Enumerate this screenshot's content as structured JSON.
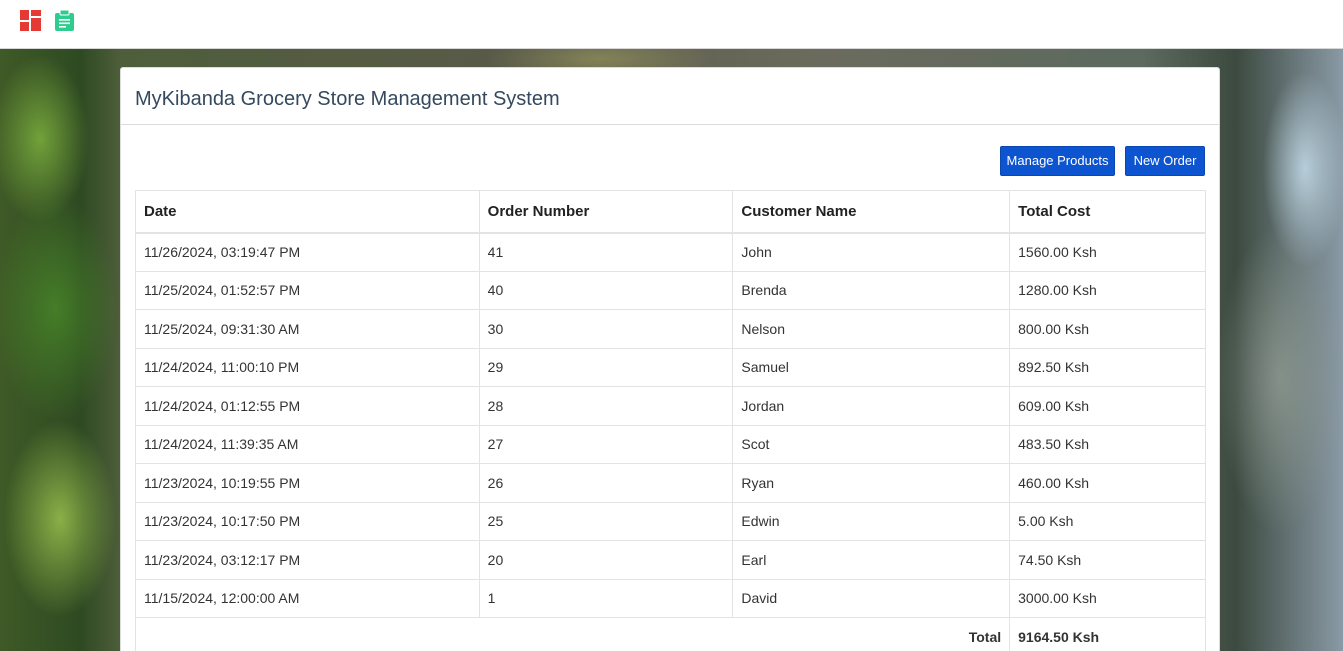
{
  "header": {
    "icons": [
      "dashboard-icon",
      "clipboard-icon"
    ]
  },
  "page": {
    "title": "MyKibanda Grocery Store Management System",
    "manage_products_label": "Manage Products",
    "new_order_label": "New Order"
  },
  "table": {
    "columns": [
      "Date",
      "Order Number",
      "Customer Name",
      "Total Cost"
    ],
    "rows": [
      [
        "11/26/2024, 03:19:47 PM",
        "41",
        "John",
        "1560.00 Ksh"
      ],
      [
        "11/25/2024, 01:52:57 PM",
        "40",
        "Brenda",
        "1280.00 Ksh"
      ],
      [
        "11/25/2024, 09:31:30 AM",
        "30",
        "Nelson",
        "800.00 Ksh"
      ],
      [
        "11/24/2024, 11:00:10 PM",
        "29",
        "Samuel",
        "892.50 Ksh"
      ],
      [
        "11/24/2024, 01:12:55 PM",
        "28",
        "Jordan",
        "609.00 Ksh"
      ],
      [
        "11/24/2024, 11:39:35 AM",
        "27",
        "Scot",
        "483.50 Ksh"
      ],
      [
        "11/23/2024, 10:19:55 PM",
        "26",
        "Ryan",
        "460.00 Ksh"
      ],
      [
        "11/23/2024, 10:17:50 PM",
        "25",
        "Edwin",
        "5.00 Ksh"
      ],
      [
        "11/23/2024, 03:12:17 PM",
        "20",
        "Earl",
        "74.50 Ksh"
      ],
      [
        "11/15/2024, 12:00:00 AM",
        "1",
        "David",
        "3000.00 Ksh"
      ]
    ],
    "total_label": "Total",
    "total_value": "9164.50 Ksh"
  },
  "colors": {
    "dashboard_icon": "#e53935",
    "clipboard_icon": "#2ecc8f",
    "button": "#0d54d1",
    "title": "#34495e"
  }
}
